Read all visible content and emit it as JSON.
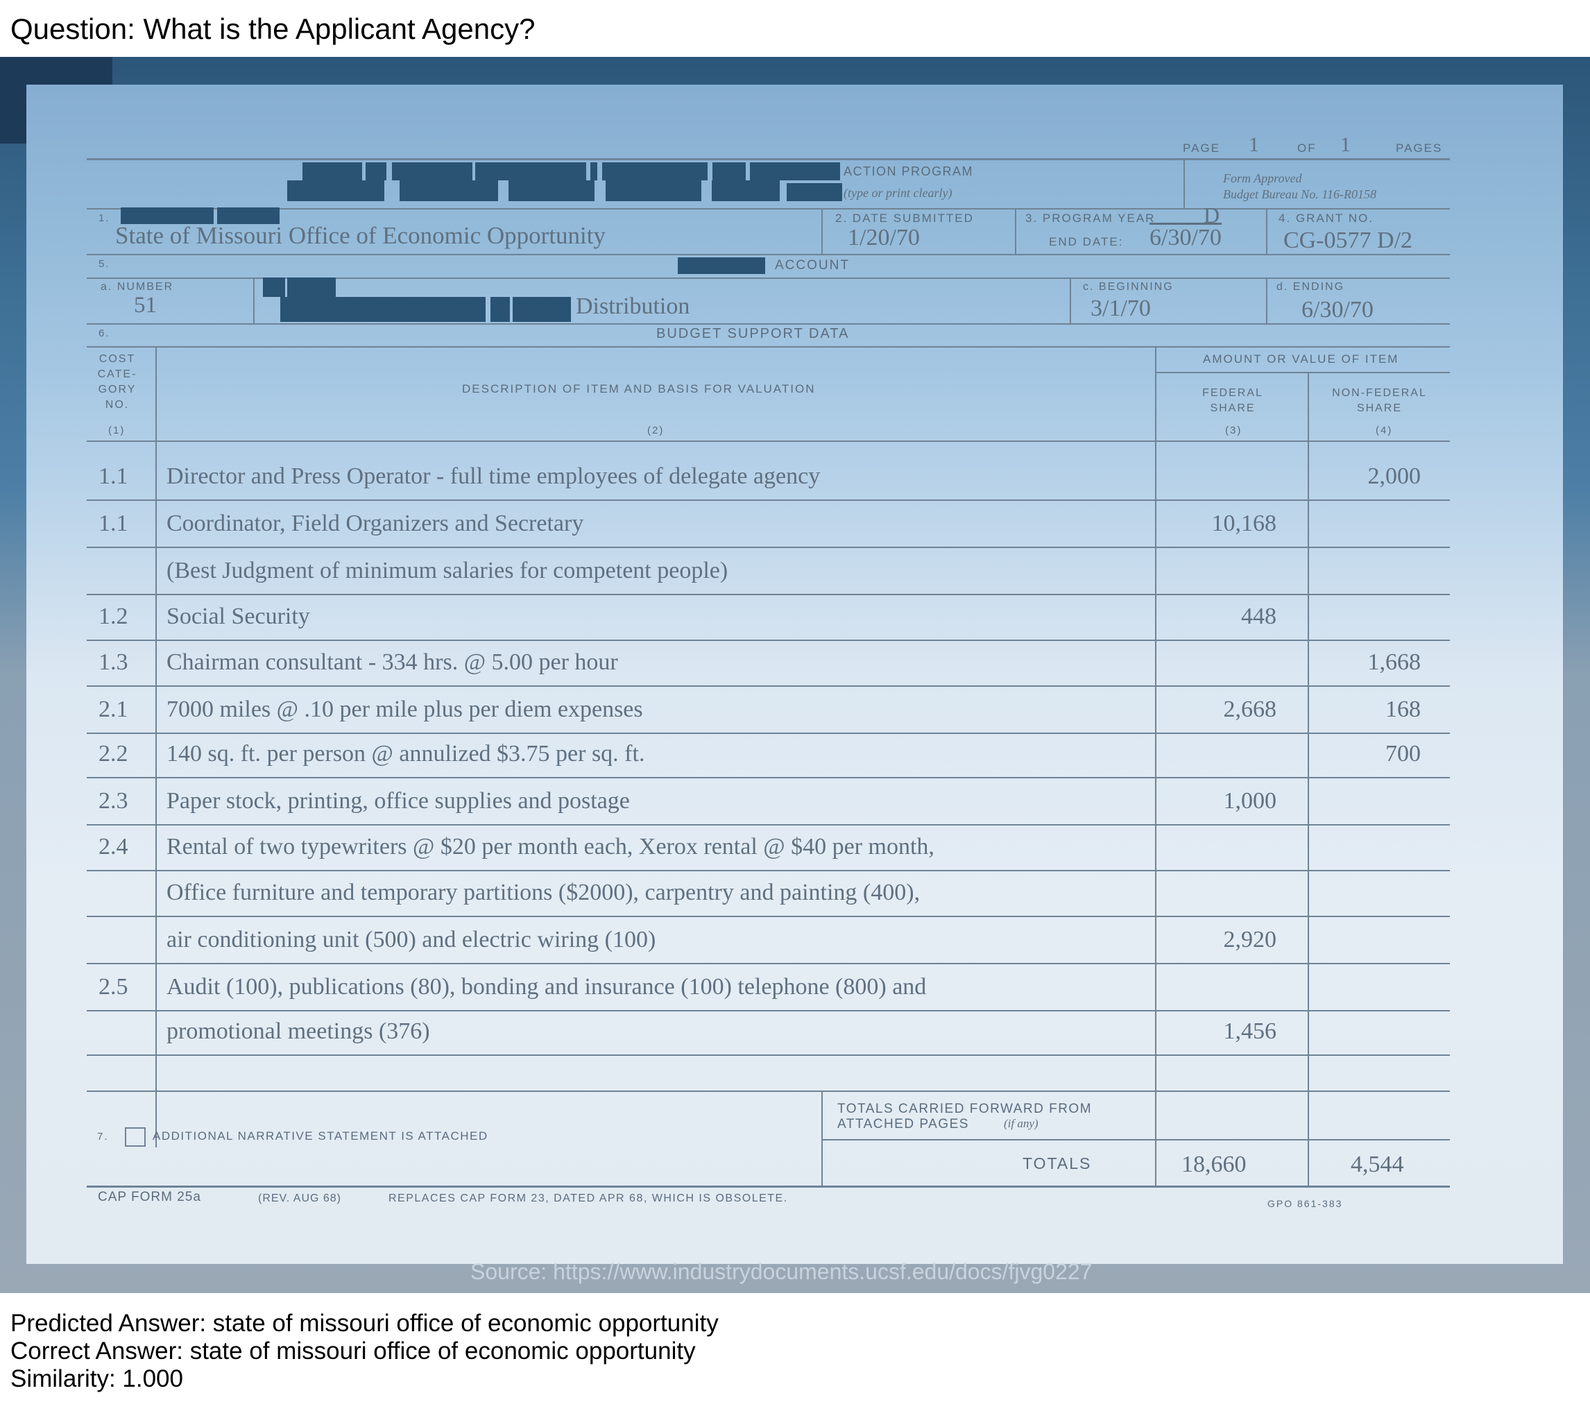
{
  "question": "Question: What is the Applicant Agency?",
  "form": {
    "page_label": "PAGE",
    "page_num": "1",
    "of_label": "OF",
    "of_num": "1",
    "pages_label": "PAGES",
    "title": "ACTION PROGRAM",
    "title_note": "(type or print clearly)",
    "form_approved": "Form Approved",
    "budget_bureau": "Budget Bureau No. 116-R0158",
    "field1_num": "1.",
    "applicant_agency": "State of Missouri Office of Economic Opportunity",
    "date_submitted_label": "2. DATE SUBMITTED",
    "date_submitted": "1/20/70",
    "program_year_label": "3. PROGRAM YEAR",
    "program_year": "D",
    "end_date_label": "END DATE:",
    "end_date": "6/30/70",
    "grant_no_label": "4. GRANT NO.",
    "grant_no": "CG-0577 D/2",
    "field5_num": "5.",
    "account_label": "ACCOUNT",
    "number_label": "a. NUMBER",
    "number": "51",
    "account_name": "Distribution",
    "beginning_label": "c. BEGINNING",
    "beginning": "3/1/70",
    "ending_label": "d. ENDING",
    "ending": "6/30/70",
    "field6_num": "6.",
    "budget_support": "BUDGET SUPPORT DATA",
    "col1_head": [
      "COST",
      "CATE-",
      "GORY",
      "NO."
    ],
    "col1_num": "(1)",
    "col2_head": "DESCRIPTION OF ITEM AND BASIS FOR VALUATION",
    "col2_num": "(2)",
    "amount_head": "AMOUNT OR VALUE OF ITEM",
    "col3_head": [
      "FEDERAL",
      "SHARE"
    ],
    "col3_num": "(3)",
    "col4_head": [
      "NON-FEDERAL",
      "SHARE"
    ],
    "col4_num": "(4)",
    "rows": [
      {
        "cat": "1.1",
        "desc": "Director and Press Operator - full time employees of delegate agency",
        "fed": "",
        "nonfed": "2,000"
      },
      {
        "cat": "1.1",
        "desc": "Coordinator,  Field Organizers and Secretary",
        "fed": "10,168",
        "nonfed": ""
      },
      {
        "cat": "",
        "desc": "(Best Judgment of minimum salaries for competent people)",
        "fed": "",
        "nonfed": ""
      },
      {
        "cat": "1.2",
        "desc": "Social Security",
        "fed": "448",
        "nonfed": ""
      },
      {
        "cat": "1.3",
        "desc": "Chairman consultant - 334 hrs. @ 5.00 per hour",
        "fed": "",
        "nonfed": "1,668"
      },
      {
        "cat": "2.1",
        "desc": "7000 miles @ .10 per mile plus per diem expenses",
        "fed": "2,668",
        "nonfed": "168"
      },
      {
        "cat": "2.2",
        "desc": "140 sq. ft. per person @ annulized $3.75 per sq. ft.",
        "fed": "",
        "nonfed": "700"
      },
      {
        "cat": "2.3",
        "desc": "Paper stock, printing, office supplies and postage",
        "fed": "1,000",
        "nonfed": ""
      },
      {
        "cat": "2.4",
        "desc": "Rental of two typewriters @ $20 per month each, Xerox rental @ $40 per month,",
        "fed": "",
        "nonfed": ""
      },
      {
        "cat": "",
        "desc": "Office furniture and temporary partitions ($2000), carpentry and painting (400),",
        "fed": "",
        "nonfed": ""
      },
      {
        "cat": "",
        "desc": "air conditioning unit (500) and electric wiring (100)",
        "fed": "2,920",
        "nonfed": ""
      },
      {
        "cat": "2.5",
        "desc": "Audit (100), publications (80), bonding and insurance (100) telephone (800) and",
        "fed": "",
        "nonfed": ""
      },
      {
        "cat": "",
        "desc": "promotional meetings (376)",
        "fed": "1,456",
        "nonfed": ""
      }
    ],
    "field7_num": "7.",
    "narrative_label": "ADDITIONAL NARRATIVE STATEMENT IS ATTACHED",
    "carried_forward": "TOTALS CARRIED FORWARD FROM",
    "attached_pages": "ATTACHED PAGES",
    "if_any": "(if any)",
    "totals_label": "TOTALS",
    "total_fed": "18,660",
    "total_nonfed": "4,544",
    "cap_form": "CAP FORM 25a",
    "rev": "(REV. AUG 68)",
    "replaces": "REPLACES CAP FORM 23, DATED APR 68, WHICH IS OBSOLETE.",
    "gpo": "GPO 861-383"
  },
  "source": "Source: https://www.industrydocuments.ucsf.edu/docs/fjvg0227",
  "predicted": "Predicted Answer: state of missouri office of economic opportunity",
  "correct": "Correct Answer: state of missouri office of economic opportunity",
  "similarity": "Similarity: 1.000"
}
